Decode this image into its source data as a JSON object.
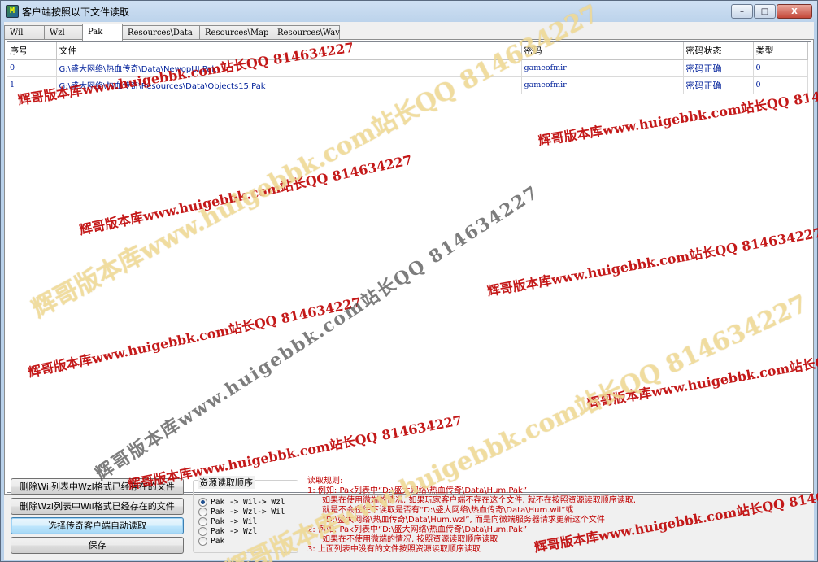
{
  "window": {
    "title": "客户端按照以下文件读取",
    "icon_name": "app-icon",
    "buttons": {
      "minimize": "–",
      "maximize": "□",
      "close": "X"
    }
  },
  "tabs": [
    {
      "label": "Wil",
      "active": false
    },
    {
      "label": "Wzl",
      "active": false
    },
    {
      "label": "Pak",
      "active": true
    },
    {
      "label": "Resources\\Data",
      "active": false
    },
    {
      "label": "Resources\\Map",
      "active": false
    },
    {
      "label": "Resources\\Wav",
      "active": false
    }
  ],
  "table": {
    "columns": [
      "序号",
      "文件",
      "密码",
      "密码状态",
      "类型"
    ],
    "rows": [
      {
        "index": "0",
        "file": "G:\\盛大网络\\热血传奇\\Data\\NewopUI.Pak",
        "password": "gameofmir",
        "status": "密码正确",
        "type": "0"
      },
      {
        "index": "1",
        "file": "G:\\盛大网络\\热血传奇\\Resources\\Data\\Objects15.Pak",
        "password": "gameofmir",
        "status": "密码正确",
        "type": "0"
      }
    ]
  },
  "buttons": {
    "delete_wil": "删除Wil列表中Wzl格式已经存在的文件",
    "delete_wzl": "删除Wzl列表中Wil格式已经存在的文件",
    "auto_read": "选择传奇客户端自动读取",
    "save": "保存"
  },
  "read_order": {
    "title": "资源读取顺序",
    "options": [
      {
        "label": "Pak -> Wil-> Wzl",
        "selected": true
      },
      {
        "label": "Pak -> Wzl-> Wil",
        "selected": false
      },
      {
        "label": "Pak -> Wil",
        "selected": false
      },
      {
        "label": "Pak -> Wzl",
        "selected": false
      },
      {
        "label": "Pak",
        "selected": false
      }
    ]
  },
  "rules": {
    "title": "读取规则:",
    "lines": [
      "1: 例如: Pak列表中“D:\\盛大网络\\热血传奇\\Data\\Hum.Pak”",
      "如果在使用微端的情况, 如果玩家客户端不存在这个文件, 就不在按照资源读取顺序读取,",
      "就是不会在往下读取是否有“D:\\盛大网络\\热血传奇\\Data\\Hum.wil”或",
      "“D:\\盛大网络\\热血传奇\\Data\\Hum.wzl”, 而是向微端服务器请求更新这个文件",
      "2: 例如: Pak列表中“D:\\盛大网络\\热血传奇\\Data\\Hum.Pak”",
      "如果在不使用微端的情况, 按照资源读取顺序读取",
      "3: 上面列表中没有的文件按照资源读取顺序读取"
    ]
  },
  "watermarks": {
    "red": "辉哥版本库www.huigebbk.com站长QQ 814634227",
    "gold": "辉哥版本库www.huigebbk.com站长QQ 814634227",
    "gray": "辉哥版本库www.huigebbk.com站长QQ 814634227"
  },
  "colors": {
    "title_bg": "#b9d1ea",
    "cell_text": "#00209a",
    "rules_text": "#c00000",
    "watermark_red": "#be0000"
  }
}
